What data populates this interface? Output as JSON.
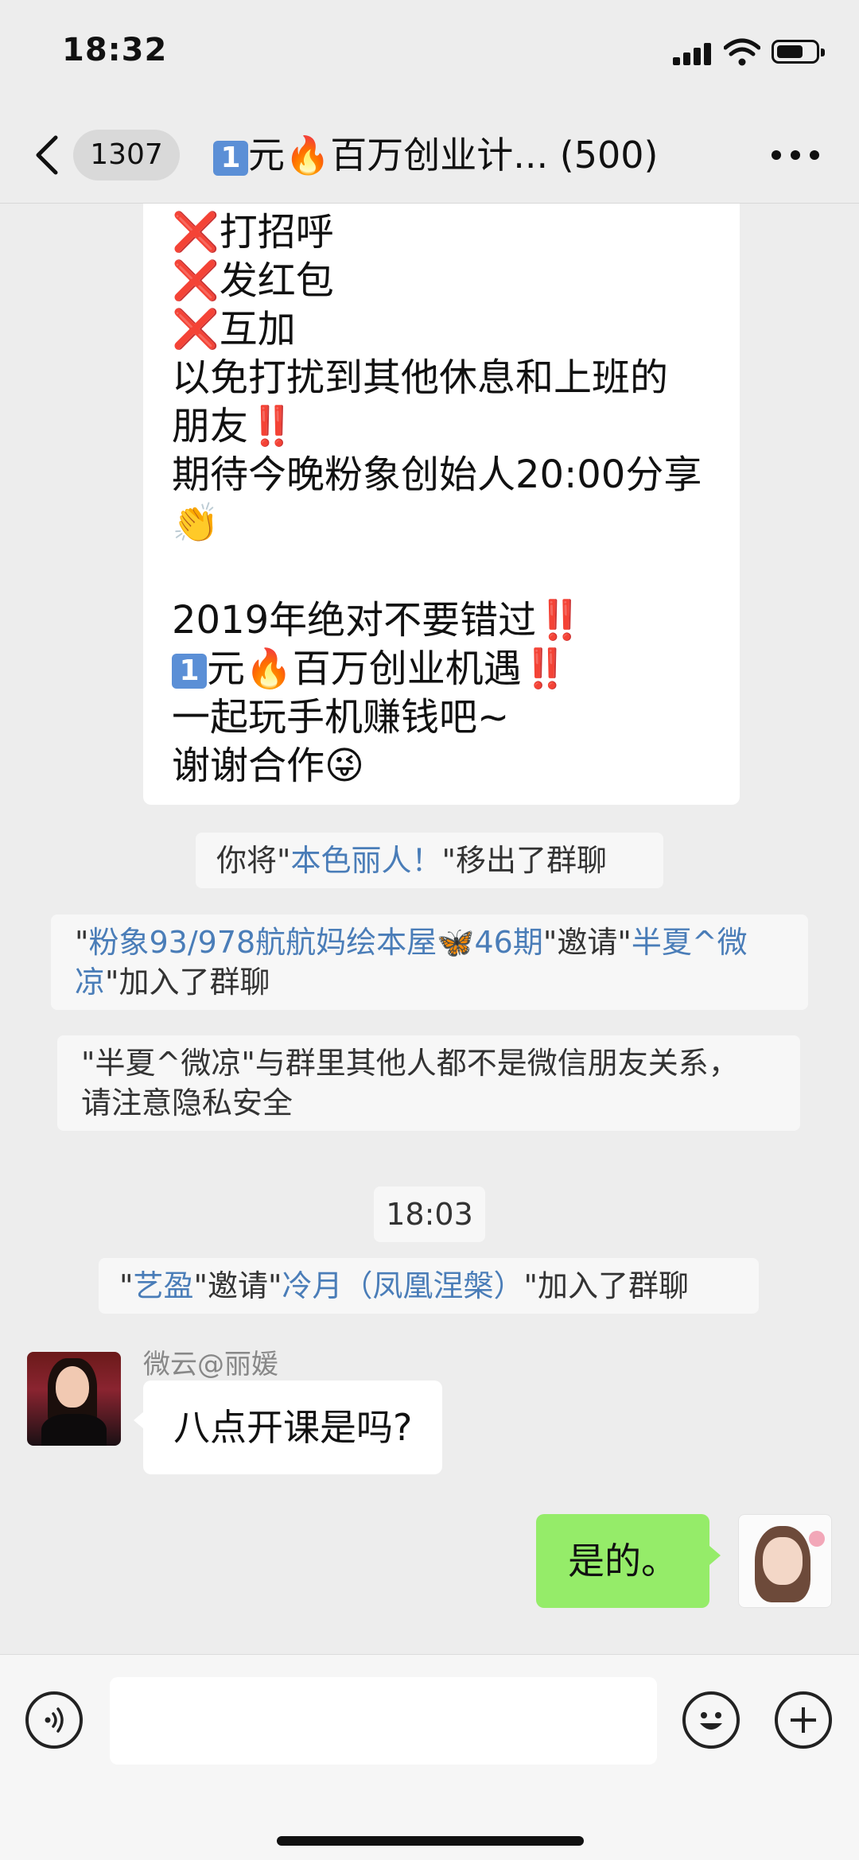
{
  "status_bar": {
    "time": "18:32"
  },
  "nav": {
    "unread_count": "1307",
    "title_prefix": "1",
    "title_rest_a": "元",
    "title_rest_b": "百万创业计... (500)"
  },
  "messages": {
    "big_message": {
      "lines": [
        {
          "mark": "❌",
          "text": "打招呼"
        },
        {
          "mark": "❌",
          "text": "发红包"
        },
        {
          "mark": "❌",
          "text": "互加"
        },
        {
          "text": "以免打扰到其他休息和上班的"
        },
        {
          "text": "朋友",
          "bang": "‼️"
        },
        {
          "text": "期待今晚粉象创始人20:00分享"
        },
        {
          "emoji": "👏"
        },
        {
          "text": ""
        },
        {
          "text": "2019年绝对不要错过",
          "bang": "‼️"
        },
        {
          "one": "1",
          "text_a": "元",
          "fire": "🔥",
          "text_b": "百万创业机遇",
          "bang": "‼️"
        },
        {
          "text": "一起玩手机赚钱吧~"
        },
        {
          "text": "谢谢合作",
          "emoji": "😜"
        }
      ]
    },
    "sys1": {
      "pre": "你将\"",
      "name": "本色丽人！",
      "post": "\"移出了群聊"
    },
    "sys2": {
      "q1": "\"",
      "name1": "粉象93/978航航妈绘本屋",
      "butterfly": "🦋",
      "name1b": "46期",
      "mid": "\"邀请\"",
      "name2": "半夏^微",
      "name2b": "凉",
      "post": "\"加入了群聊"
    },
    "sys3": {
      "line1": "\"半夏^微凉\"与群里其他人都不是微信朋友关系，",
      "line2": "请注意隐私安全"
    },
    "time_divider": "18:03",
    "sys4": {
      "q1": "\"",
      "name1": "艺盈",
      "mid": "\"邀请\"",
      "name2": "冷月（凤凰涅槃）",
      "post": "\"加入了群聊"
    },
    "incoming": {
      "sender": "微云@丽媛",
      "text": "八点开课是吗?"
    },
    "outgoing": {
      "text": "是的。"
    }
  },
  "icons": [
    "back-chevron-icon",
    "more-icon",
    "voice-icon",
    "emoji-icon",
    "plus-icon"
  ],
  "colors": {
    "bg": "#ededed",
    "outgoing_bubble": "#95ec69",
    "link_name": "#4a7db8"
  }
}
